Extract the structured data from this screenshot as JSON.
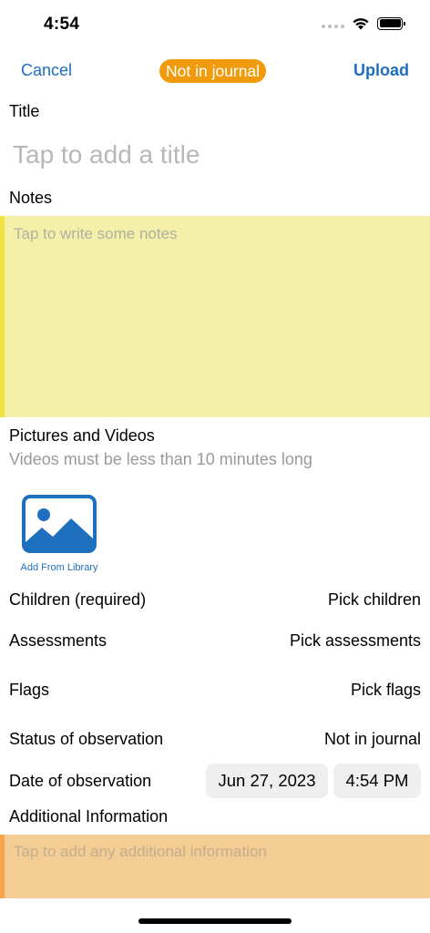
{
  "status_bar": {
    "time": "4:54",
    "icons": [
      "cellular-signal-icon",
      "wifi-icon",
      "battery-icon"
    ]
  },
  "nav": {
    "cancel_label": "Cancel",
    "status_badge": "Not in journal",
    "upload_label": "Upload"
  },
  "title_section": {
    "label": "Title",
    "placeholder": "Tap to add a title"
  },
  "notes_section": {
    "label": "Notes",
    "placeholder": "Tap to write some notes"
  },
  "media_section": {
    "label": "Pictures and Videos",
    "hint": "Videos must be less than 10 minutes long",
    "add_library_label": "Add From Library",
    "add_library_icon": "photo-library-icon"
  },
  "rows": {
    "children": {
      "label": "Children (required)",
      "value": "Pick children"
    },
    "assessments": {
      "label": "Assessments",
      "value": "Pick assessments"
    },
    "flags": {
      "label": "Flags",
      "value": "Pick flags"
    },
    "status": {
      "label": "Status of observation",
      "value": "Not in journal"
    },
    "date": {
      "label": "Date of observation",
      "date": "Jun 27, 2023",
      "time": "4:54 PM"
    }
  },
  "additional_section": {
    "label": "Additional Information",
    "placeholder": "Tap to add any additional information"
  },
  "colors": {
    "accent_blue": "#1f6fbf",
    "badge_orange": "#f09a0c",
    "notes_yellow": "#f4f0a9",
    "notes_border": "#f0e440",
    "additional_orange": "#f4cd94",
    "additional_border": "#f5a64a"
  }
}
